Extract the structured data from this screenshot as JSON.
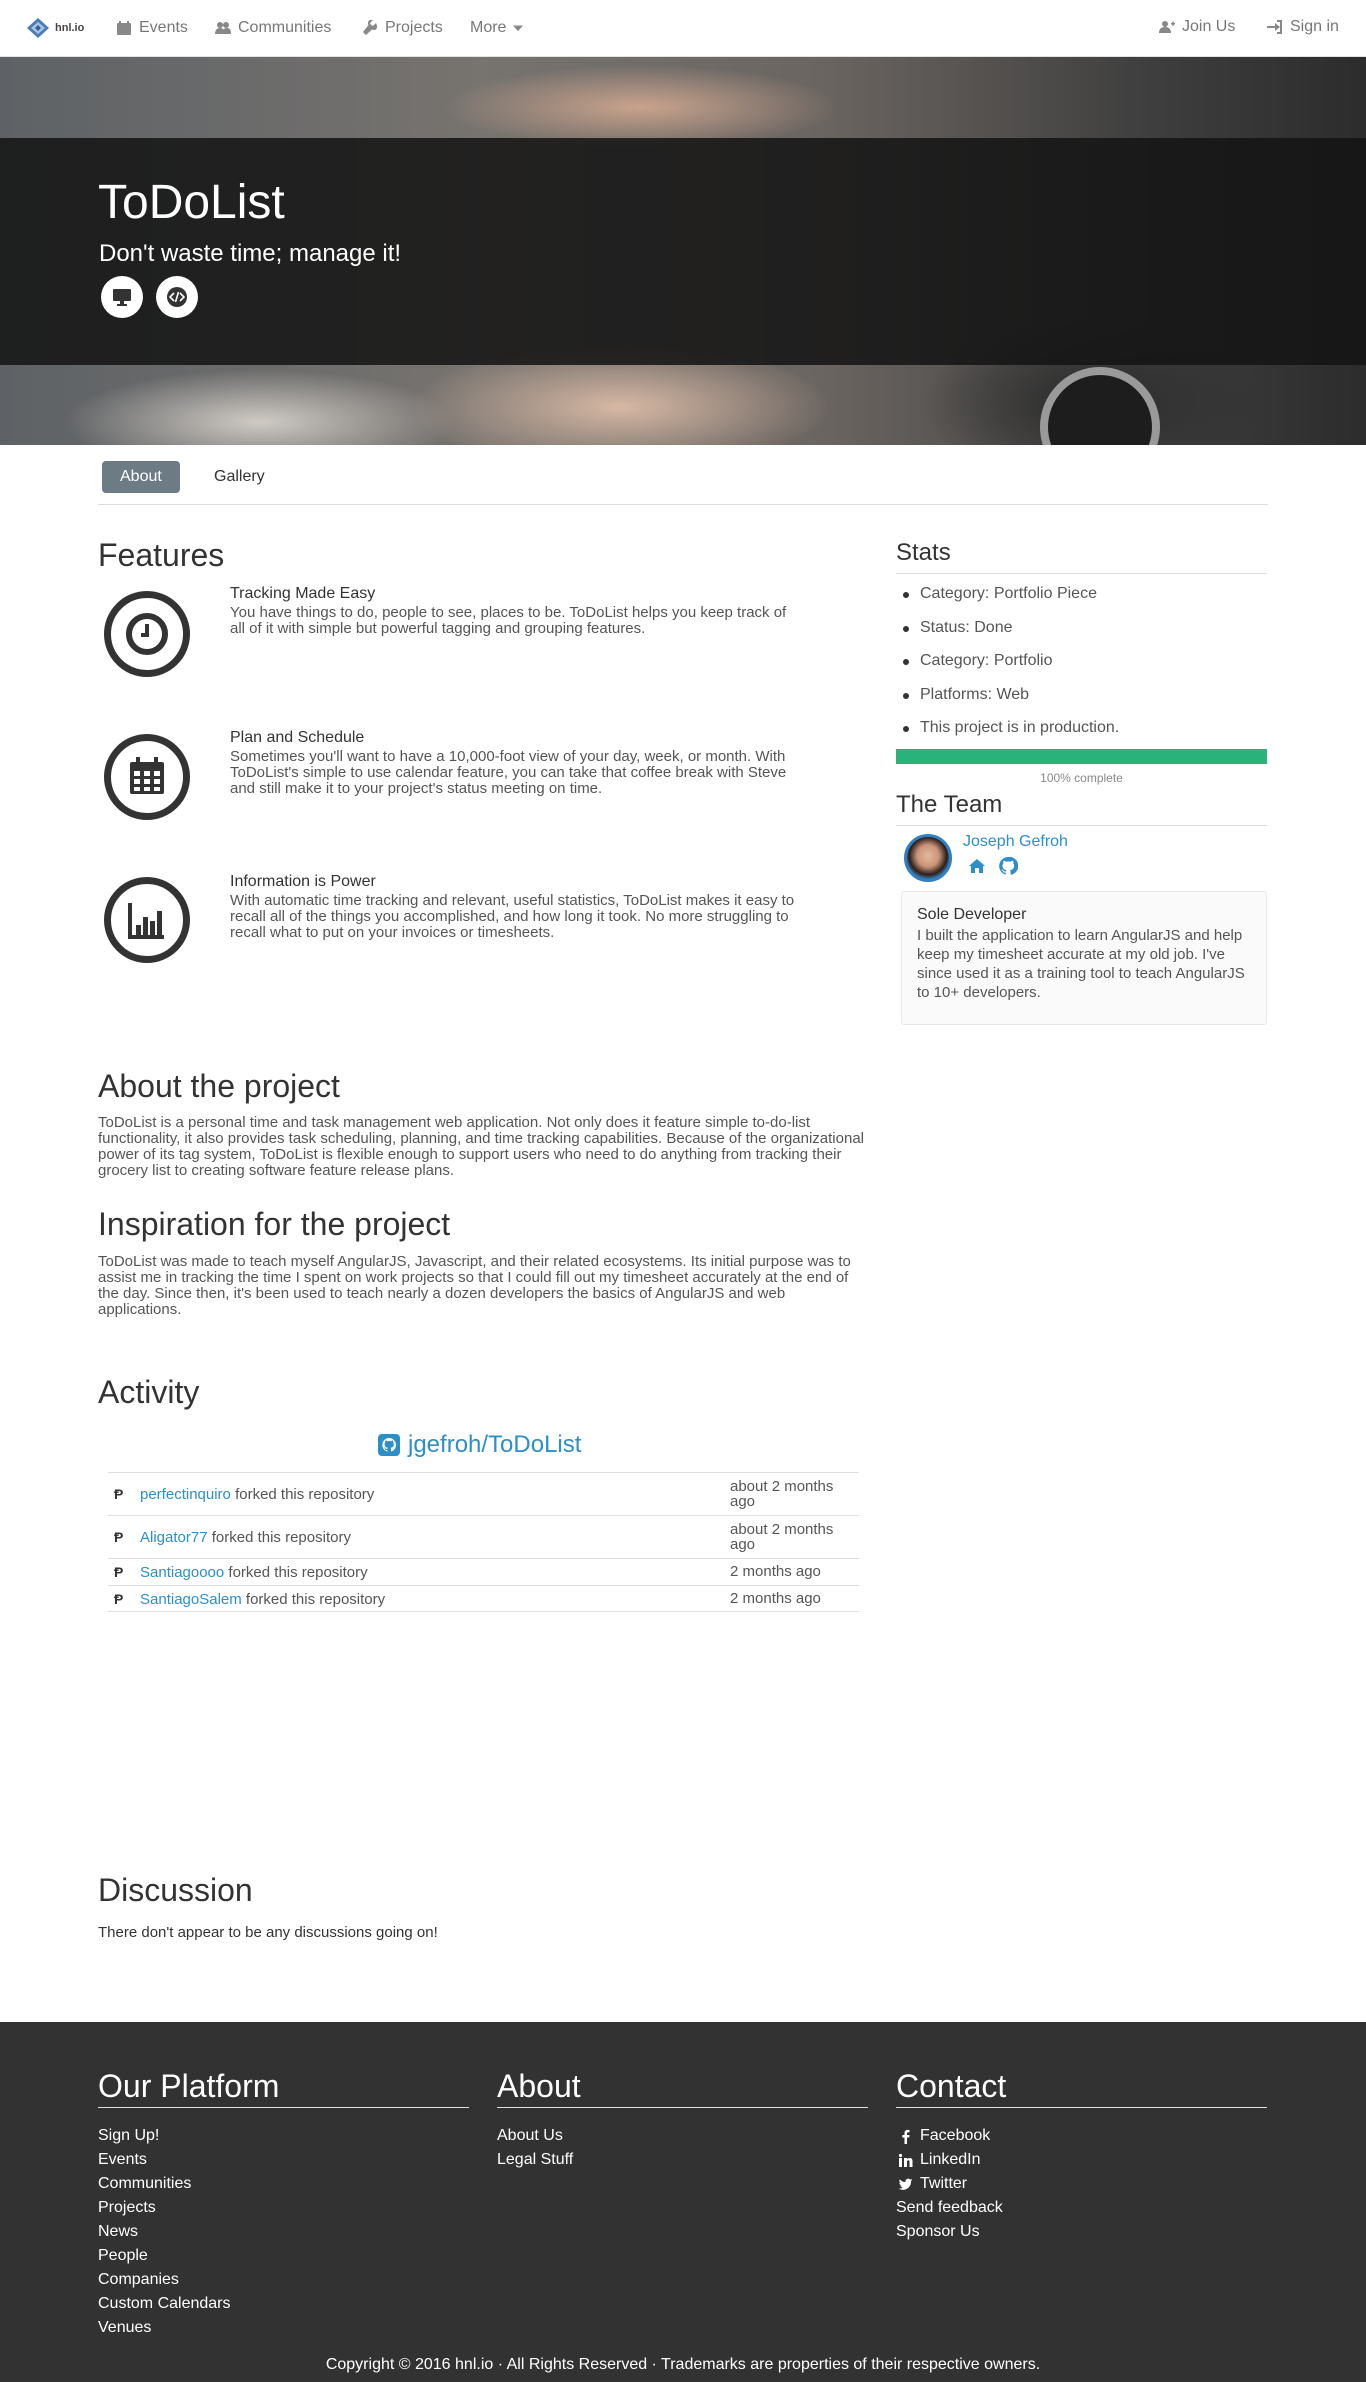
{
  "nav": {
    "brand": "hnl.io",
    "items": [
      {
        "label": "Events",
        "icon": "calendar-icon"
      },
      {
        "label": "Communities",
        "icon": "users-icon"
      },
      {
        "label": "Projects",
        "icon": "wrench-icon"
      },
      {
        "label": "More",
        "icon": "caret-down-icon"
      }
    ],
    "join": "Join Us",
    "signin": "Sign in"
  },
  "hero": {
    "title": "ToDoList",
    "subtitle": "Don't waste time; manage it!",
    "buttons": [
      {
        "icon": "desktop-icon"
      },
      {
        "icon": "code-icon"
      }
    ]
  },
  "tabs": [
    "About",
    "Gallery"
  ],
  "features": {
    "heading": "Features",
    "items": [
      {
        "title": "Tracking Made Easy",
        "icon": "clock-icon",
        "text": "You have things to do, people to see, places to be. ToDoList helps you keep track of all of it with simple but powerful tagging and grouping features."
      },
      {
        "title": "Plan and Schedule",
        "icon": "calendar-icon",
        "text": "Sometimes you'll want to have a 10,000-foot view of your day, week, or month. With ToDoList's simple to use calendar feature, you can take that coffee break with Steve and still make it to your project's status meeting on time."
      },
      {
        "title": "Information is Power",
        "icon": "bar-chart-icon",
        "text": "With automatic time tracking and relevant, useful statistics, ToDoList makes it easy to recall all of the things you accomplished, and how long it took. No more struggling to recall what to put on your invoices or timesheets."
      }
    ]
  },
  "about": {
    "heading": "About the project",
    "text": "ToDoList is a personal time and task management web application. Not only does it feature simple to-do-list functionality, it also provides task scheduling, planning, and time tracking capabilities. Because of the organizational power of its tag system, ToDoList is flexible enough to support users who need to do anything from tracking their grocery list to creating software feature release plans."
  },
  "inspiration": {
    "heading": "Inspiration for the project",
    "text": "ToDoList was made to teach myself AngularJS, Javascript, and their related ecosystems. Its initial purpose was to assist me in tracking the time I spent on work projects so that I could fill out my timesheet accurately at the end of the day. Since then, it's been used to teach nearly a dozen developers the basics of AngularJS and web applications."
  },
  "activity": {
    "heading": "Activity",
    "repo": "jgefroh/ToDoList",
    "rows": [
      {
        "user": "perfectinquiro",
        "action": "forked this repository",
        "time": "about 2 months ago"
      },
      {
        "user": "Aligator77",
        "action": "forked this repository",
        "time": "about 2 months ago"
      },
      {
        "user": "Santiagoooo",
        "action": "forked this repository",
        "time": "2 months ago"
      },
      {
        "user": "SantiagoSalem",
        "action": "forked this repository",
        "time": "2 months ago"
      }
    ]
  },
  "discussion": {
    "heading": "Discussion",
    "text": "There don't appear to be any discussions going on!"
  },
  "stats": {
    "heading": "Stats",
    "items": [
      "Category: Portfolio Piece",
      "Status: Done",
      "Category: Portfolio",
      "Platforms: Web",
      "This project is in production."
    ],
    "progress": 1.0,
    "progress_label": "100% complete",
    "progress_color": "#2ab27b"
  },
  "team": {
    "heading": "The Team",
    "member": {
      "name": "Joseph Gefroh",
      "icons": [
        "home-icon",
        "github-icon"
      ]
    },
    "role": "Sole Developer",
    "role_text": "I built the application to learn AngularJS and help keep my timesheet accurate at my old job. I've since used it as a training tool to teach AngularJS to 10+ developers."
  },
  "footer": {
    "platform": {
      "heading": "Our Platform",
      "links": [
        "Sign Up!",
        "Events",
        "Communities",
        "Projects",
        "News",
        "People",
        "Companies",
        "Custom Calendars",
        "Venues"
      ]
    },
    "about": {
      "heading": "About",
      "links": [
        "About Us",
        "Legal Stuff"
      ]
    },
    "contact": {
      "heading": "Contact",
      "links": [
        {
          "label": "Facebook",
          "icon": "facebook-icon"
        },
        {
          "label": "LinkedIn",
          "icon": "linkedin-icon"
        },
        {
          "label": "Twitter",
          "icon": "twitter-icon"
        },
        {
          "label": "Send feedback",
          "icon": ""
        },
        {
          "label": "Sponsor Us",
          "icon": ""
        }
      ]
    },
    "copyright": "Copyright © 2016 hnl.io · All Rights Reserved · Trademarks are properties of their respective owners."
  },
  "colors": {
    "accent": "#2c8fc7",
    "footer_bg": "#323232",
    "tab_active": "#6d7b85"
  }
}
